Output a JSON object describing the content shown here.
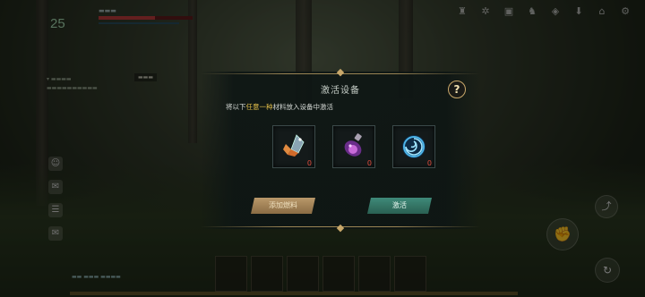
{
  "dialog": {
    "title": "激活设备",
    "help_label": "?",
    "instruction_prefix": "将以下",
    "instruction_highlight": "任意一种",
    "instruction_suffix": "材料放入设备中激活",
    "items": [
      {
        "icon": "crystal-shard-icon",
        "count": "0"
      },
      {
        "icon": "purple-potion-icon",
        "count": "0"
      },
      {
        "icon": "blue-swirl-orb-icon",
        "count": "0"
      }
    ],
    "add_fuel_label": "添加燃料",
    "activate_label": "激活"
  },
  "hud": {
    "level": "25"
  },
  "colors": {
    "highlight": "#e6c14a",
    "count_red": "#e04b3d",
    "activate_btn": "#3f8a79",
    "fuel_btn": "#b9986a",
    "gold_trim": "#c9a86a"
  }
}
